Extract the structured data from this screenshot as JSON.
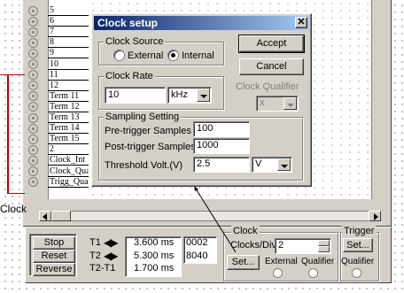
{
  "left_label": "Clock",
  "channel_rows": [
    "5",
    "6",
    "7",
    "8",
    "9",
    "10",
    "11",
    "12",
    "Term 11",
    "Term 12",
    "Term 13",
    "Term 14",
    "Term 15",
    "2",
    "Clock_Int",
    "Clock_Qua",
    "Trigg_Qua"
  ],
  "dialog": {
    "title": "Clock setup",
    "clock_source": {
      "label": "Clock Source",
      "external": "External",
      "internal": "Internal",
      "selected": "internal"
    },
    "clock_rate": {
      "label": "Clock Rate",
      "value": "10",
      "unit": "kHz"
    },
    "clock_qualifier": {
      "label": "Clock Qualifier",
      "value": "x"
    },
    "sampling": {
      "label": "Sampling Setting",
      "pre_label": "Pre-trigger Samples",
      "pre_value": "100",
      "post_label": "Post-trigger Samples",
      "post_value": "1000",
      "threshold_label": "Threshold Volt.(V)",
      "threshold_value": "2.5",
      "threshold_unit": "V"
    },
    "accept": "Accept",
    "cancel": "Cancel"
  },
  "controls": {
    "stop": "Stop",
    "reset": "Reset",
    "reverse": "Reverse",
    "t1": "T1",
    "t2": "T2",
    "t2t1": "T2-T1",
    "t1_time": "3.600 ms",
    "t2_time": "5.300 ms",
    "diff_time": "1.700 ms",
    "t1_count": "0002",
    "t2_count": "8040"
  },
  "clock_panel": {
    "title": "Clock",
    "clocks_div_label": "Clocks/Div",
    "clocks_div_value": "2",
    "set": "Set...",
    "external": "External",
    "qualifier": "Qualifier"
  },
  "trigger_panel": {
    "title": "Trigger",
    "set": "Set...",
    "qualifier": "Qualifier"
  }
}
